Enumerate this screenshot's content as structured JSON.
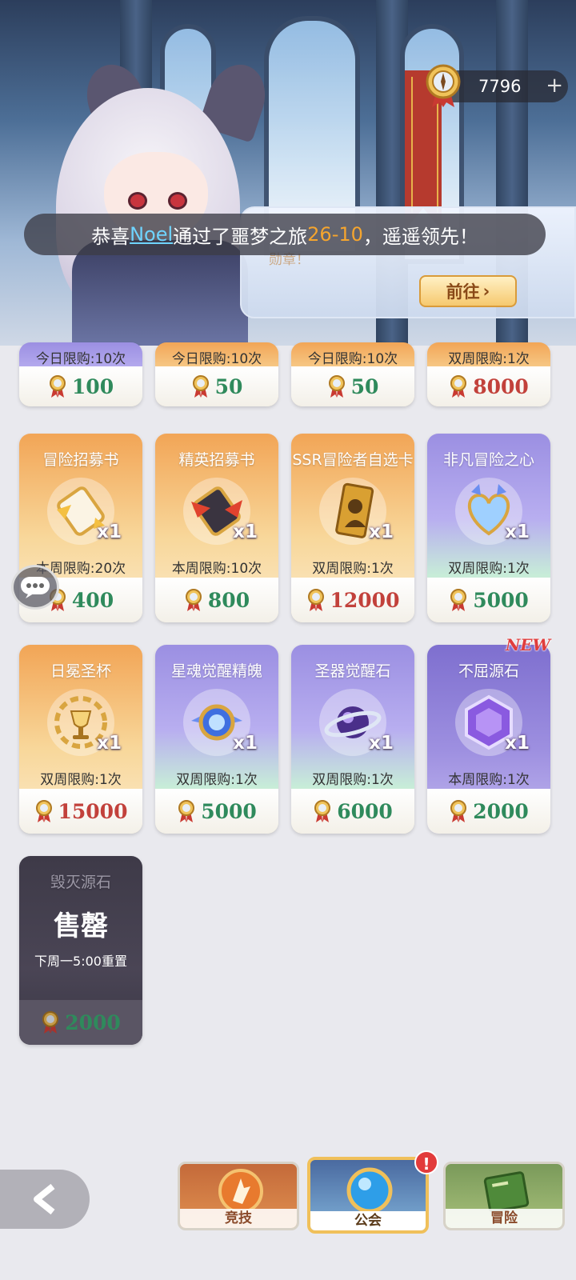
{
  "header": {
    "currency_value": "7796",
    "currency_plus": "+",
    "goto_label": "前往",
    "goto_arrow": "›",
    "faint_notice": "勋章！",
    "marquee": {
      "prefix": "恭喜",
      "name": "Noel",
      "middle": "通过了噩梦之旅",
      "level": "26-10",
      "suffix": "，遥遥领先！"
    }
  },
  "top_row": [
    {
      "limit": "今日限购:10次",
      "price": "100",
      "price_color": "green",
      "style": "purple"
    },
    {
      "limit": "今日限购:10次",
      "price": "50",
      "price_color": "green",
      "style": "gold"
    },
    {
      "limit": "今日限购:10次",
      "price": "50",
      "price_color": "green",
      "style": "gold"
    },
    {
      "limit": "双周限购:1次",
      "price": "8000",
      "price_color": "red",
      "style": "gold"
    }
  ],
  "items": [
    {
      "name": "冒险招募书",
      "qty": "x1",
      "limit": "本周限购:20次",
      "price": "400",
      "price_color": "green",
      "icon": "scroll-icon"
    },
    {
      "name": "精英招募书",
      "qty": "x1",
      "limit": "本周限购:10次",
      "price": "800",
      "price_color": "green",
      "icon": "elite-scroll-icon"
    },
    {
      "name": "SSR冒险者自选卡",
      "qty": "x1",
      "limit": "双周限购:1次",
      "price": "12000",
      "price_color": "red",
      "icon": "card-icon"
    },
    {
      "name": "非凡冒险之心",
      "qty": "x1",
      "limit": "双周限购:1次",
      "price": "5000",
      "price_color": "green",
      "icon": "heart-gem-icon"
    },
    {
      "name": "日冕圣杯",
      "qty": "x1",
      "limit": "双周限购:1次",
      "price": "15000",
      "price_color": "red",
      "icon": "grail-icon"
    },
    {
      "name": "星魂觉醒精魄",
      "qty": "x1",
      "limit": "双周限购:1次",
      "price": "5000",
      "price_color": "green",
      "icon": "star-soul-icon"
    },
    {
      "name": "圣器觉醒石",
      "qty": "x1",
      "limit": "双周限购:1次",
      "price": "6000",
      "price_color": "green",
      "icon": "orb-icon"
    },
    {
      "name": "不屈源石",
      "qty": "x1",
      "limit": "本周限购:1次",
      "price": "2000",
      "price_color": "green",
      "icon": "hex-stone-icon",
      "new_tag": "NEW"
    }
  ],
  "sold_item": {
    "name": "毁灭源石",
    "stamp": "售罄",
    "reset": "下周一5:00重置",
    "price": "2000"
  },
  "nav": {
    "tab_arena": "竞技",
    "tab_guild": "公会",
    "tab_adventure": "冒险",
    "guild_badge": "!"
  }
}
